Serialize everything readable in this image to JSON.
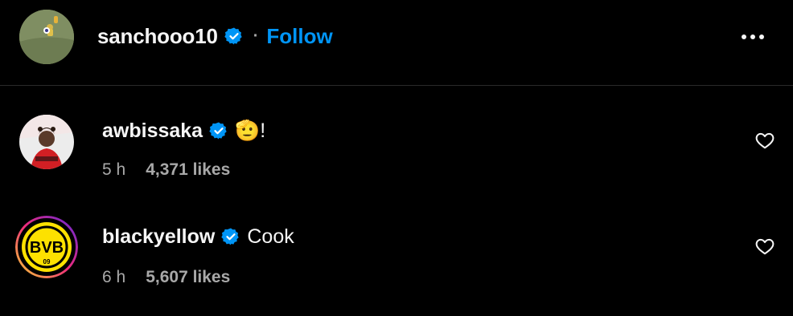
{
  "post_header": {
    "username": "sanchooo10",
    "separator": "·",
    "follow_label": "Follow",
    "verified": true,
    "more_icon": "more-horizontal-icon"
  },
  "comments": [
    {
      "username": "awbissaka",
      "verified": true,
      "text": "🫡!",
      "time": "5 h",
      "likes": "4,371 likes",
      "like_icon": "heart-outline-icon"
    },
    {
      "username": "blackyellow",
      "verified": true,
      "text": "Cook",
      "time": "6 h",
      "likes": "5,607 likes",
      "like_icon": "heart-outline-icon",
      "avatar_logo_text": "BVB 09"
    }
  ],
  "colors": {
    "background": "#000000",
    "text": "#f5f5f5",
    "secondary_text": "#a8a8a8",
    "follow": "#0095f6",
    "verified_badge": "#0095f6",
    "divider": "#2a2a2a",
    "bvb_yellow": "#fde100"
  }
}
